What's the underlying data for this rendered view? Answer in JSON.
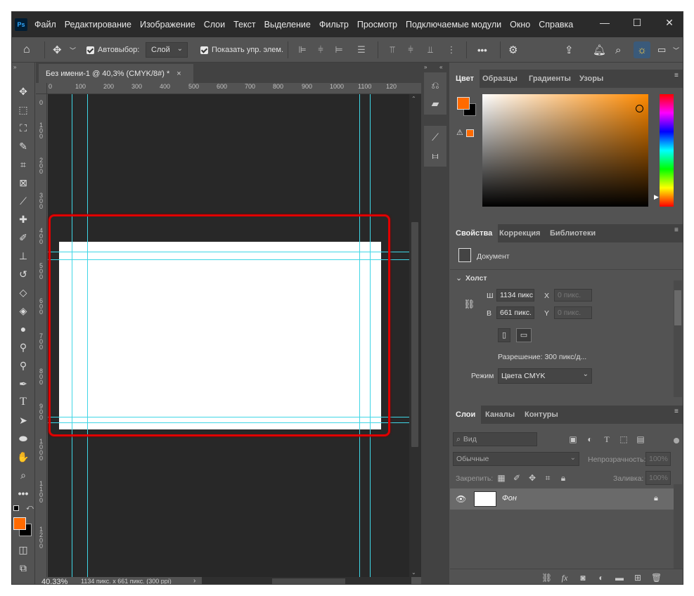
{
  "app": {
    "logo": "Ps"
  },
  "menu": [
    "Файл",
    "Редактирование",
    "Изображение",
    "Слои",
    "Текст",
    "Выделение",
    "Фильтр",
    "Просмотр",
    "Подключаемые модули",
    "Окно",
    "Справка"
  ],
  "window_controls": {
    "minimize": "—",
    "maximize": "☐",
    "close": "✕"
  },
  "options_bar": {
    "auto_select_label": "Автовыбор:",
    "auto_select_value": "Слой",
    "show_controls_label": "Показать упр. элем.",
    "more": "•••"
  },
  "document": {
    "tab_title": "Без имени-1 @ 40,3% (CMYK/8#) *",
    "tab_close": "×",
    "zoom": "40,33%",
    "status_info": "1134 пикс. x 661 пикс. (300 ppi)",
    "ruler_h_labels": [
      "0",
      "100",
      "200",
      "300",
      "400",
      "500",
      "600",
      "700",
      "800",
      "900",
      "1000",
      "1100",
      "120"
    ],
    "ruler_v_labels": [
      "0",
      "1\n0\n0",
      "2\n0\n0",
      "3\n0\n0",
      "4\n0\n0",
      "5\n0\n0",
      "6\n0\n0",
      "7\n0\n0",
      "8\n0\n0",
      "9\n0\n0",
      "1\n0\n0\n0",
      "1\n1\n0\n0",
      "1\n2\n0\n0"
    ]
  },
  "color_panel": {
    "tabs": [
      "Цвет",
      "Образцы",
      "Градиенты",
      "Узоры"
    ],
    "foreground": "#ff6a00",
    "background": "#000000",
    "picker_hue": "#ff8a00"
  },
  "properties_panel": {
    "tabs": [
      "Свойства",
      "Коррекция",
      "Библиотеки"
    ],
    "doc_label": "Документ",
    "section": "Холст",
    "w_label": "Ш",
    "w_value": "1134 пикс",
    "h_label": "В",
    "h_value": "661 пикс.",
    "x_label": "X",
    "x_placeholder": "0 пикс.",
    "y_label": "Y",
    "y_placeholder": "0 пикс.",
    "resolution": "Разрешение: 300 пикс/д...",
    "mode_label": "Режим",
    "mode_value": "Цвета CMYK"
  },
  "layers_panel": {
    "tabs": [
      "Слои",
      "Каналы",
      "Контуры"
    ],
    "filter_placeholder": "Вид",
    "blend_mode": "Обычные",
    "opacity_label": "Непрозрачность:",
    "opacity_value": "100%",
    "lock_label": "Закрепить:",
    "fill_label": "Заливка:",
    "fill_value": "100%",
    "layers": [
      {
        "name": "Фон",
        "visible": true,
        "locked": true
      }
    ]
  },
  "accent": {
    "annotation_frame": "#e00000",
    "guide": "#3fd6e6"
  }
}
